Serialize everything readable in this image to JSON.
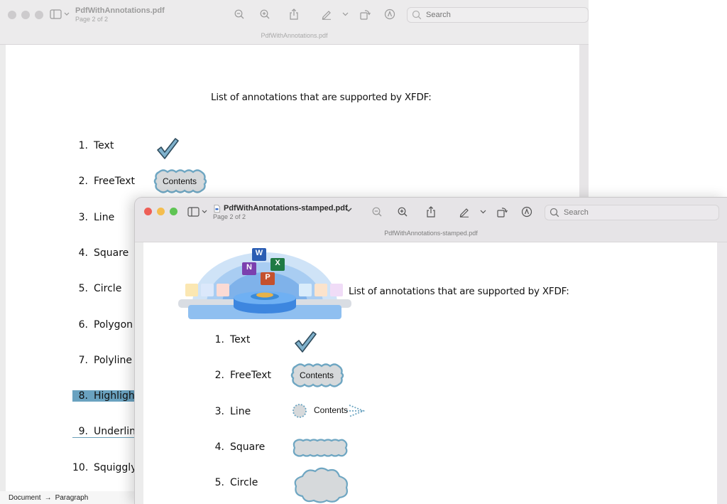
{
  "back_window": {
    "title": "PdfWithAnnotations.pdf",
    "page_indicator": "Page 2 of 2",
    "subtitle": "PdfWithAnnotations.pdf",
    "search_placeholder": "Search",
    "heading": "List of annotations that are supported by XFDF:",
    "items": [
      {
        "num": "1.",
        "label": "Text"
      },
      {
        "num": "2.",
        "label": "FreeText"
      },
      {
        "num": "3.",
        "label": "Line"
      },
      {
        "num": "4.",
        "label": "Square"
      },
      {
        "num": "5.",
        "label": "Circle"
      },
      {
        "num": "6.",
        "label": "Polygon"
      },
      {
        "num": "7.",
        "label": "Polyline"
      },
      {
        "num": "8.",
        "label": "Highlight"
      },
      {
        "num": "9.",
        "label": "Underline"
      },
      {
        "num": "10.",
        "label": "Squiggly"
      }
    ],
    "freetext_contents": "Contents"
  },
  "front_window": {
    "title": "PdfWithAnnotations-stamped.pdf",
    "page_indicator": "Page 2 of 2",
    "subtitle": "PdfWithAnnotations-stamped.pdf",
    "search_placeholder": "Search",
    "heading": "List of annotations that are supported by XFDF:",
    "items": [
      {
        "num": "1.",
        "label": "Text"
      },
      {
        "num": "2.",
        "label": "FreeText"
      },
      {
        "num": "3.",
        "label": "Line"
      },
      {
        "num": "4.",
        "label": "Square"
      },
      {
        "num": "5.",
        "label": "Circle"
      }
    ],
    "freetext_contents": "Contents",
    "line_contents": "Contents",
    "stamp_app_letters": [
      "W",
      "N",
      "X",
      "P"
    ]
  },
  "breadcrumbs": {
    "first": "Document",
    "arrow": "→",
    "second": "Paragraph"
  },
  "colors": {
    "annotation_fill": "#d4d7d9",
    "annotation_border": "#6b9fb8",
    "highlight": "#6aa2c0",
    "close": "#ee5f57",
    "minimize": "#f4bd4f",
    "zoom": "#5fc454",
    "inactive_light": "#cdcbcd"
  },
  "icons": [
    "sidebar-icon",
    "zoom-out-icon",
    "zoom-in-icon",
    "share-icon",
    "markup-pen-icon",
    "rotate-icon",
    "annotate-icon",
    "search-icon",
    "pdf-file-icon",
    "chevron-down-icon"
  ]
}
